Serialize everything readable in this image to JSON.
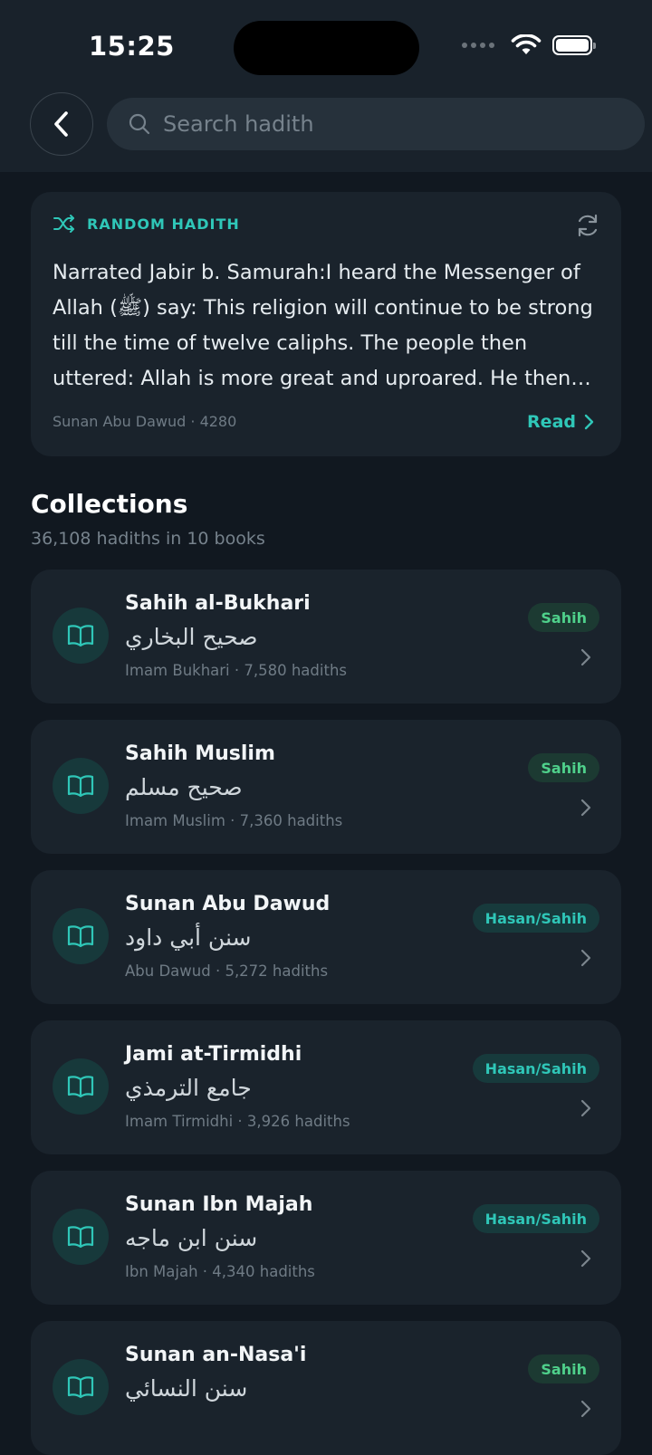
{
  "status_bar": {
    "time": "15:25"
  },
  "search": {
    "placeholder": "Search hadith"
  },
  "random_hadith": {
    "label": "RANDOM HADITH",
    "text": "Narrated Jabir b. Samurah:I heard the Messenger of Allah (ﷺ) say: This religion will continue to be strong till the time of twelve caliphs. The people then uttered: Allah is more great and uproared. He then…",
    "source": "Sunan Abu Dawud · 4280",
    "read_label": "Read"
  },
  "collections": {
    "title": "Collections",
    "subtitle": "36,108 hadiths in 10 books",
    "books": [
      {
        "name": "Sahih al-Bukhari",
        "arabic": "صحيح البخاري",
        "meta": "Imam Bukhari · 7,580 hadiths",
        "grade": "Sahih"
      },
      {
        "name": "Sahih Muslim",
        "arabic": "صحيح مسلم",
        "meta": "Imam Muslim · 7,360 hadiths",
        "grade": "Sahih"
      },
      {
        "name": "Sunan Abu Dawud",
        "arabic": "سنن أبي داود",
        "meta": "Abu Dawud · 5,272 hadiths",
        "grade": "Hasan/Sahih"
      },
      {
        "name": "Jami at-Tirmidhi",
        "arabic": "جامع الترمذي",
        "meta": "Imam Tirmidhi · 3,926 hadiths",
        "grade": "Hasan/Sahih"
      },
      {
        "name": "Sunan Ibn Majah",
        "arabic": "سنن ابن ماجه",
        "meta": "Ibn Majah · 4,340 hadiths",
        "grade": "Hasan/Sahih"
      },
      {
        "name": "Sunan an-Nasa'i",
        "arabic": "سنن النسائي",
        "meta": "",
        "grade": "Sahih"
      }
    ]
  },
  "colors": {
    "accent": "#2fc7b8",
    "sahih": "#4fd18b",
    "background": "#111820",
    "card": "#1a232c"
  }
}
